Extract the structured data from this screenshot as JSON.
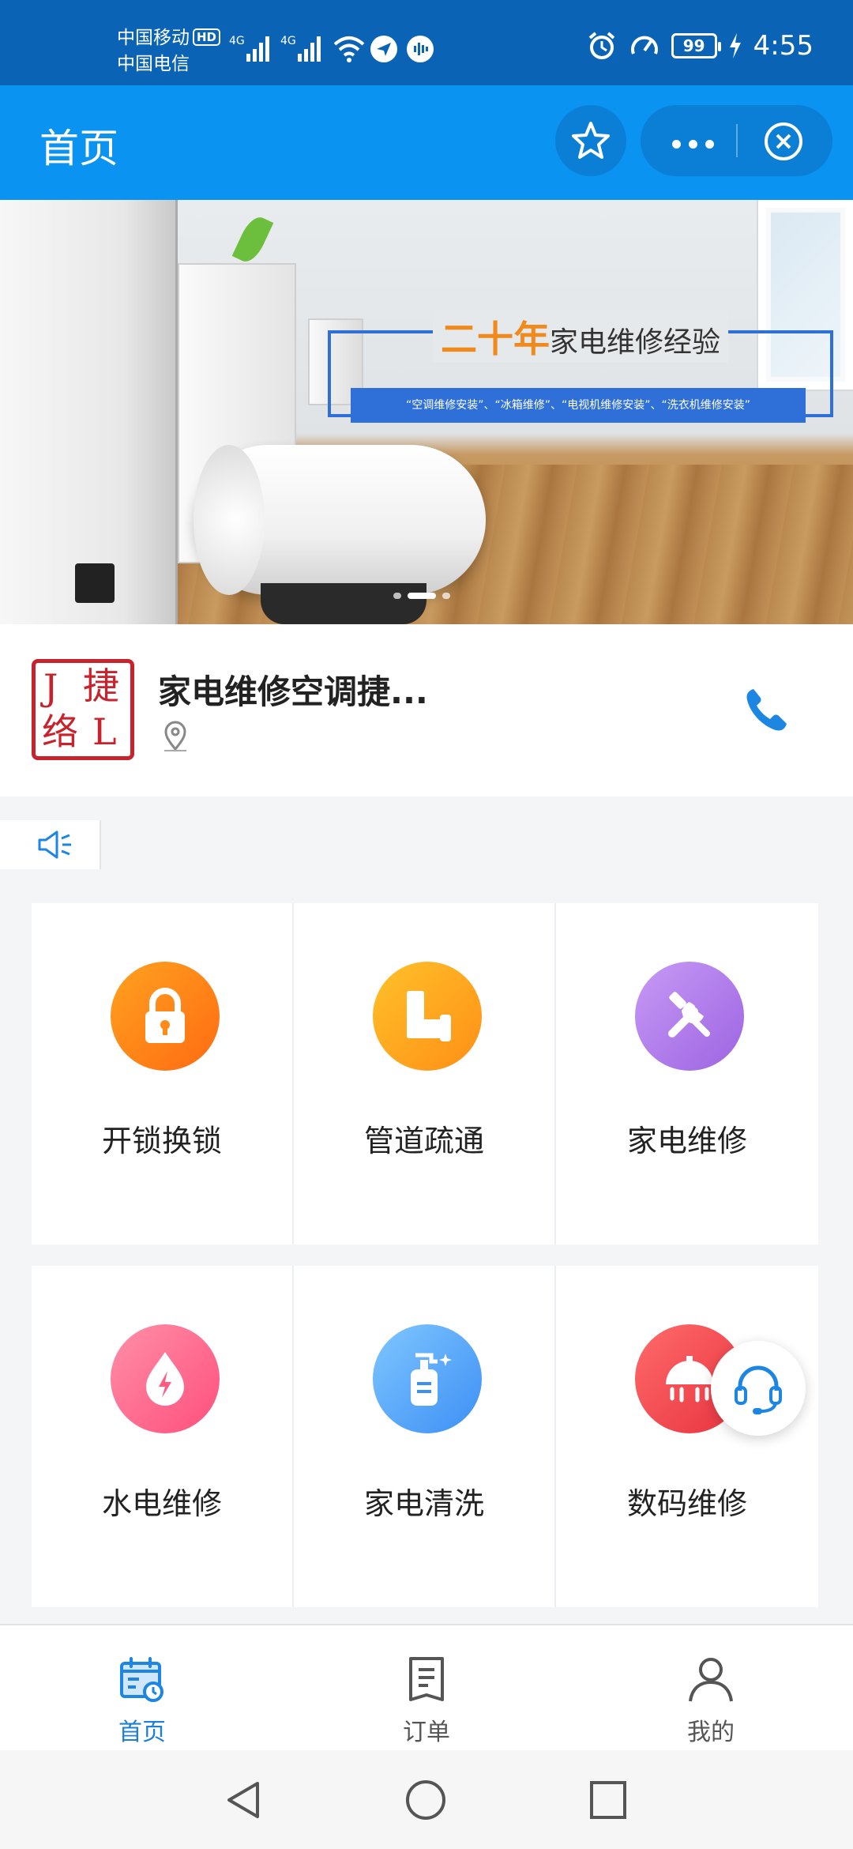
{
  "status_bar": {
    "carrier_1": "中国移动",
    "carrier_1_badge": "HD",
    "carrier_2": "中国电信",
    "network_1": "4G",
    "network_2": "4G",
    "battery": "99",
    "time": "4:55"
  },
  "header": {
    "title": "首页"
  },
  "banner": {
    "headline_highlight": "二十年",
    "headline_rest": "家电维修经验",
    "tags": "“空调维修安装”、“冰箱维修”、“电视机维修安装”、“洗衣机维修安装”",
    "active_slide": 2,
    "slide_count": 3
  },
  "shop": {
    "name": "家电维修空调捷...",
    "logo_chars": [
      "J",
      "捷",
      "络",
      "L"
    ]
  },
  "services": [
    {
      "label": "开锁换锁",
      "icon": "lock-icon",
      "color_from": "#ffa21f",
      "color_to": "#ff6b12"
    },
    {
      "label": "管道疏通",
      "icon": "pipe-icon",
      "color_from": "#ffc12a",
      "color_to": "#ff8f16"
    },
    {
      "label": "家电维修",
      "icon": "tools-icon",
      "color_from": "#c79af5",
      "color_to": "#9d64e2"
    },
    {
      "label": "水电维修",
      "icon": "water-electric-icon",
      "color_from": "#ff8fa8",
      "color_to": "#ff4f7c"
    },
    {
      "label": "家电清洗",
      "icon": "soap-bottle-icon",
      "color_from": "#7fc6ff",
      "color_to": "#3d8ff5"
    },
    {
      "label": "数码维修",
      "icon": "lamp-icon",
      "color_from": "#ff6b6b",
      "color_to": "#e8333f"
    }
  ],
  "tabbar": {
    "items": [
      {
        "label": "首页",
        "icon": "calendar-icon",
        "active": true
      },
      {
        "label": "订单",
        "icon": "order-icon",
        "active": false
      },
      {
        "label": "我的",
        "icon": "user-icon",
        "active": false
      }
    ]
  },
  "colors": {
    "status_bar": "#0a63b4",
    "header": "#0a93f0",
    "accent": "#1d7fd6"
  }
}
